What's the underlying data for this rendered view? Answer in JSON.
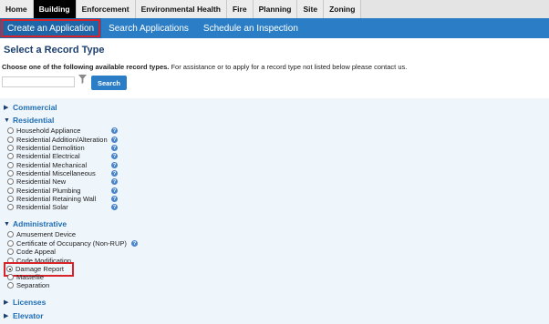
{
  "topnav": {
    "tabs": [
      "Home",
      "Building",
      "Enforcement",
      "Environmental Health",
      "Fire",
      "Planning",
      "Site",
      "Zoning"
    ],
    "active": "Building"
  },
  "subnav": {
    "links": [
      "Create an Application",
      "Search Applications",
      "Schedule an Inspection"
    ],
    "selected": "Create an Application"
  },
  "page": {
    "title": "Select a Record Type",
    "instruction_bold": "Choose one of the following available record types.",
    "instruction_rest": " For assistance or to apply for a record type not listed below please contact us.",
    "search_value": "",
    "search_button": "Search"
  },
  "groups": {
    "commercial": {
      "label": "Commercial",
      "expanded": false
    },
    "residential": {
      "label": "Residential",
      "expanded": true,
      "items": [
        "Household Appliance",
        "Residential Addition/Alteration",
        "Residential Demolition",
        "Residential Electrical",
        "Residential Mechanical",
        "Residential Miscellaneous",
        "Residential New",
        "Residential Plumbing",
        "Residential Retaining Wall",
        "Residential Solar"
      ]
    },
    "administrative": {
      "label": "Administrative",
      "expanded": true,
      "items": [
        "Amusement Device",
        "Certificate of Occupancy (Non-RUP)",
        "Code Appeal",
        "Code Modification",
        "Damage Report",
        "Mastefile",
        "Separation"
      ],
      "selected": "Damage Report"
    },
    "licenses": {
      "label": "Licenses",
      "expanded": false
    },
    "elevator": {
      "label": "Elevator",
      "expanded": false
    }
  },
  "icons": {
    "expanded_arrow": "▼",
    "collapsed_arrow": "▶",
    "help": "?"
  },
  "colors": {
    "accent_blue": "#2b7ec6",
    "highlight_red": "#d8232a",
    "panel_bg": "#eef5fb",
    "link_blue": "#1f6db3"
  }
}
